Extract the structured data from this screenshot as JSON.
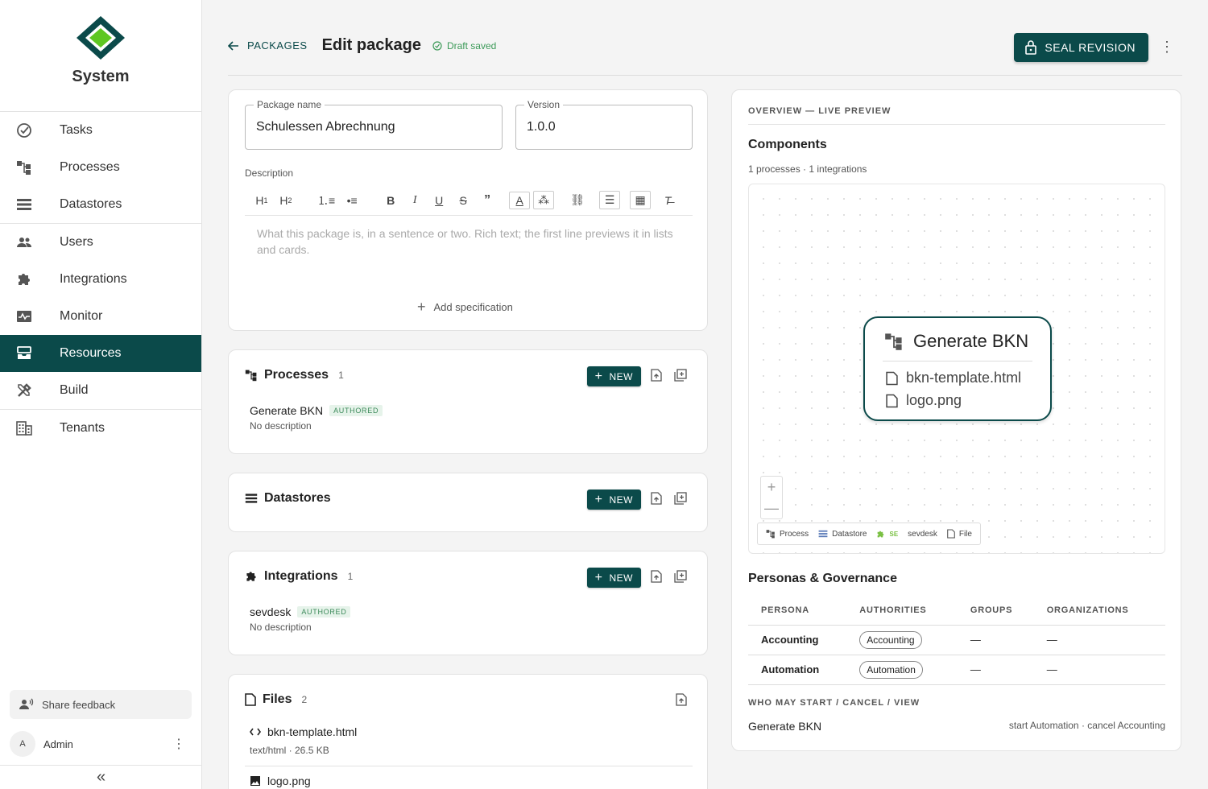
{
  "app": {
    "name": "System"
  },
  "sidebar": {
    "items": [
      {
        "label": "Tasks",
        "icon": "check-circle-icon"
      },
      {
        "label": "Processes",
        "icon": "process-icon"
      },
      {
        "label": "Datastores",
        "icon": "datastore-icon"
      },
      {
        "label": "Users",
        "icon": "users-icon"
      },
      {
        "label": "Integrations",
        "icon": "puzzle-icon"
      },
      {
        "label": "Monitor",
        "icon": "monitor-icon"
      },
      {
        "label": "Resources",
        "icon": "inbox-icon",
        "active": true
      },
      {
        "label": "Build",
        "icon": "tools-icon"
      },
      {
        "label": "Tenants",
        "icon": "building-icon"
      }
    ],
    "feedback": "Share feedback",
    "user": {
      "initial": "A",
      "name": "Admin"
    }
  },
  "header": {
    "back_label": "PACKAGES",
    "title": "Edit package",
    "status": "Draft saved",
    "seal_label": "SEAL REVISION"
  },
  "form": {
    "name_label": "Package name",
    "name_value": "Schulessen Abrechnung",
    "version_label": "Version",
    "version_value": "1.0.0",
    "description_label": "Description",
    "toolbar": [
      "H1",
      "H2",
      "ordered-list",
      "bullet-list",
      "B",
      "I",
      "U",
      "S",
      "quote",
      "text-color",
      "highlight",
      "link",
      "align",
      "table",
      "clear-format"
    ],
    "description_placeholder": "What this package is, in a sentence or two. Rich text; the first line previews it in lists and cards.",
    "add_spec": "Add specification"
  },
  "sections": {
    "new_label": "NEW",
    "processes": {
      "title": "Processes",
      "count": "1",
      "items": [
        {
          "name": "Generate BKN",
          "badge": "AUTHORED",
          "desc": "No description"
        }
      ]
    },
    "datastores": {
      "title": "Datastores"
    },
    "integrations": {
      "title": "Integrations",
      "count": "1",
      "items": [
        {
          "name": "sevdesk",
          "badge": "AUTHORED",
          "desc": "No description"
        }
      ]
    },
    "files": {
      "title": "Files",
      "count": "2",
      "items": [
        {
          "name": "bkn-template.html",
          "meta": "text/html · 26.5 KB"
        },
        {
          "name": "logo.png"
        }
      ]
    }
  },
  "overview": {
    "label": "OVERVIEW — LIVE PREVIEW",
    "components_title": "Components",
    "components_sub": "1 processes · 1 integrations",
    "node": {
      "title": "Generate BKN",
      "files": [
        "bkn-template.html",
        "logo.png"
      ]
    },
    "zoom_in": "+",
    "zoom_out": "—",
    "legend": {
      "process": "Process",
      "datastore": "Datastore",
      "se_tag": "SE",
      "integration": "sevdesk",
      "file": "File"
    },
    "personas_title": "Personas & Governance",
    "columns": [
      "PERSONA",
      "AUTHORITIES",
      "GROUPS",
      "ORGANIZATIONS"
    ],
    "personas": [
      {
        "name": "Accounting",
        "authority": "Accounting",
        "groups": "—",
        "orgs": "—"
      },
      {
        "name": "Automation",
        "authority": "Automation",
        "groups": "—",
        "orgs": "—"
      }
    ],
    "who_label": "WHO MAY START / CANCEL / VIEW",
    "who": {
      "process": "Generate BKN",
      "rules": "start Automation · cancel Accounting"
    }
  },
  "colors": {
    "primary": "#0b4a4a",
    "accent_green": "#7ac043",
    "success": "#3c9a58"
  }
}
